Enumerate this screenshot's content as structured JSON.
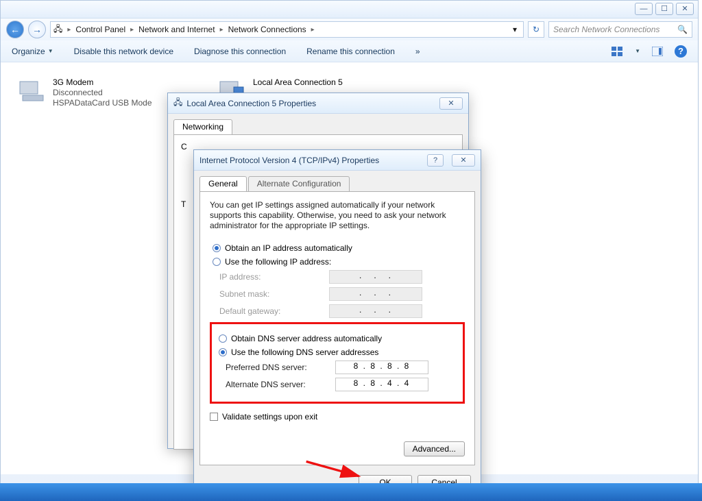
{
  "window": {
    "min": "—",
    "max": "☐",
    "close": "✕"
  },
  "breadcrumb": {
    "cp": "Control Panel",
    "net": "Network and Internet",
    "nc": "Network Connections",
    "search_placeholder": "Search Network Connections"
  },
  "cmdbar": {
    "organize": "Organize",
    "disable": "Disable this network device",
    "diagnose": "Diagnose this connection",
    "rename": "Rename this connection",
    "more": "»"
  },
  "connections": {
    "modem": {
      "name": "3G Modem",
      "status": "Disconnected",
      "device": "HSPADataCard USB Mode"
    },
    "lac5": {
      "name": "Local Area Connection 5"
    }
  },
  "dlg1": {
    "title": "Local Area Connection 5 Properties",
    "tab_networking": "Networking",
    "connect_using_hint": "C",
    "this_conn": "T"
  },
  "dlg2": {
    "title": "Internet Protocol Version 4 (TCP/IPv4) Properties",
    "tab_general": "General",
    "tab_alt": "Alternate Configuration",
    "info": "You can get IP settings assigned automatically if your network supports this capability. Otherwise, you need to ask your network administrator for the appropriate IP settings.",
    "obtain_ip": "Obtain an IP address automatically",
    "use_ip": "Use the following IP address:",
    "ip_address": "IP address:",
    "subnet": "Subnet mask:",
    "gateway": "Default gateway:",
    "obtain_dns": "Obtain DNS server address automatically",
    "use_dns": "Use the following DNS server addresses",
    "pref_dns": "Preferred DNS server:",
    "alt_dns": "Alternate DNS server:",
    "pref_dns_val": "8  .  8  .  8  .  8",
    "alt_dns_val": "8  .  8  .  4  .  4",
    "validate": "Validate settings upon exit",
    "advanced": "Advanced...",
    "ok": "OK",
    "cancel": "Cancel"
  }
}
